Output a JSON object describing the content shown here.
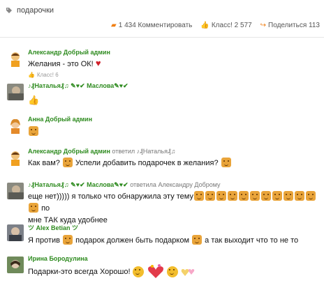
{
  "tag": {
    "label": "подарочки"
  },
  "stats": {
    "comments": "1 434 Комментировать",
    "klass": "Класс! 2 577",
    "share": "Поделиться 113"
  },
  "comments": [
    {
      "author": "Александр Добрый админ",
      "text": "Желания - это ОК!",
      "klass": "Класс! 6"
    },
    {
      "author": "♪₰Наталья₰♫ ✎♥✔ Маслова✎♥✔"
    },
    {
      "author": "Анна Добрый админ"
    },
    {
      "author": "Александр Добрый админ",
      "reply_prefix": "ответил",
      "reply_to": "♪₰Наталья₰♫",
      "text_a": "Как вам?",
      "text_b": "Успели добавить подарочек в желания?"
    },
    {
      "author": "♪₰Наталья₰♫ ✎♥✔ Маслова✎♥✔",
      "reply_prefix": "ответила",
      "reply_to": "Александру Доброму",
      "text_a": "еще нет))))) я только что обнаружила эту тему",
      "text_b": "по",
      "text_c": "мне  ТАК куда удобнее"
    },
    {
      "author": "ツ Alex Betian ツ",
      "text_a": "Я против",
      "text_b": "подарок должен быть подарком",
      "text_c": "а так выходит что то не то"
    },
    {
      "author": "Ирина Бородулина",
      "text": "Подарки-это всегда Хорошо!"
    }
  ],
  "colors": {
    "accent": "#f07f13",
    "author": "#2e8b1f"
  }
}
